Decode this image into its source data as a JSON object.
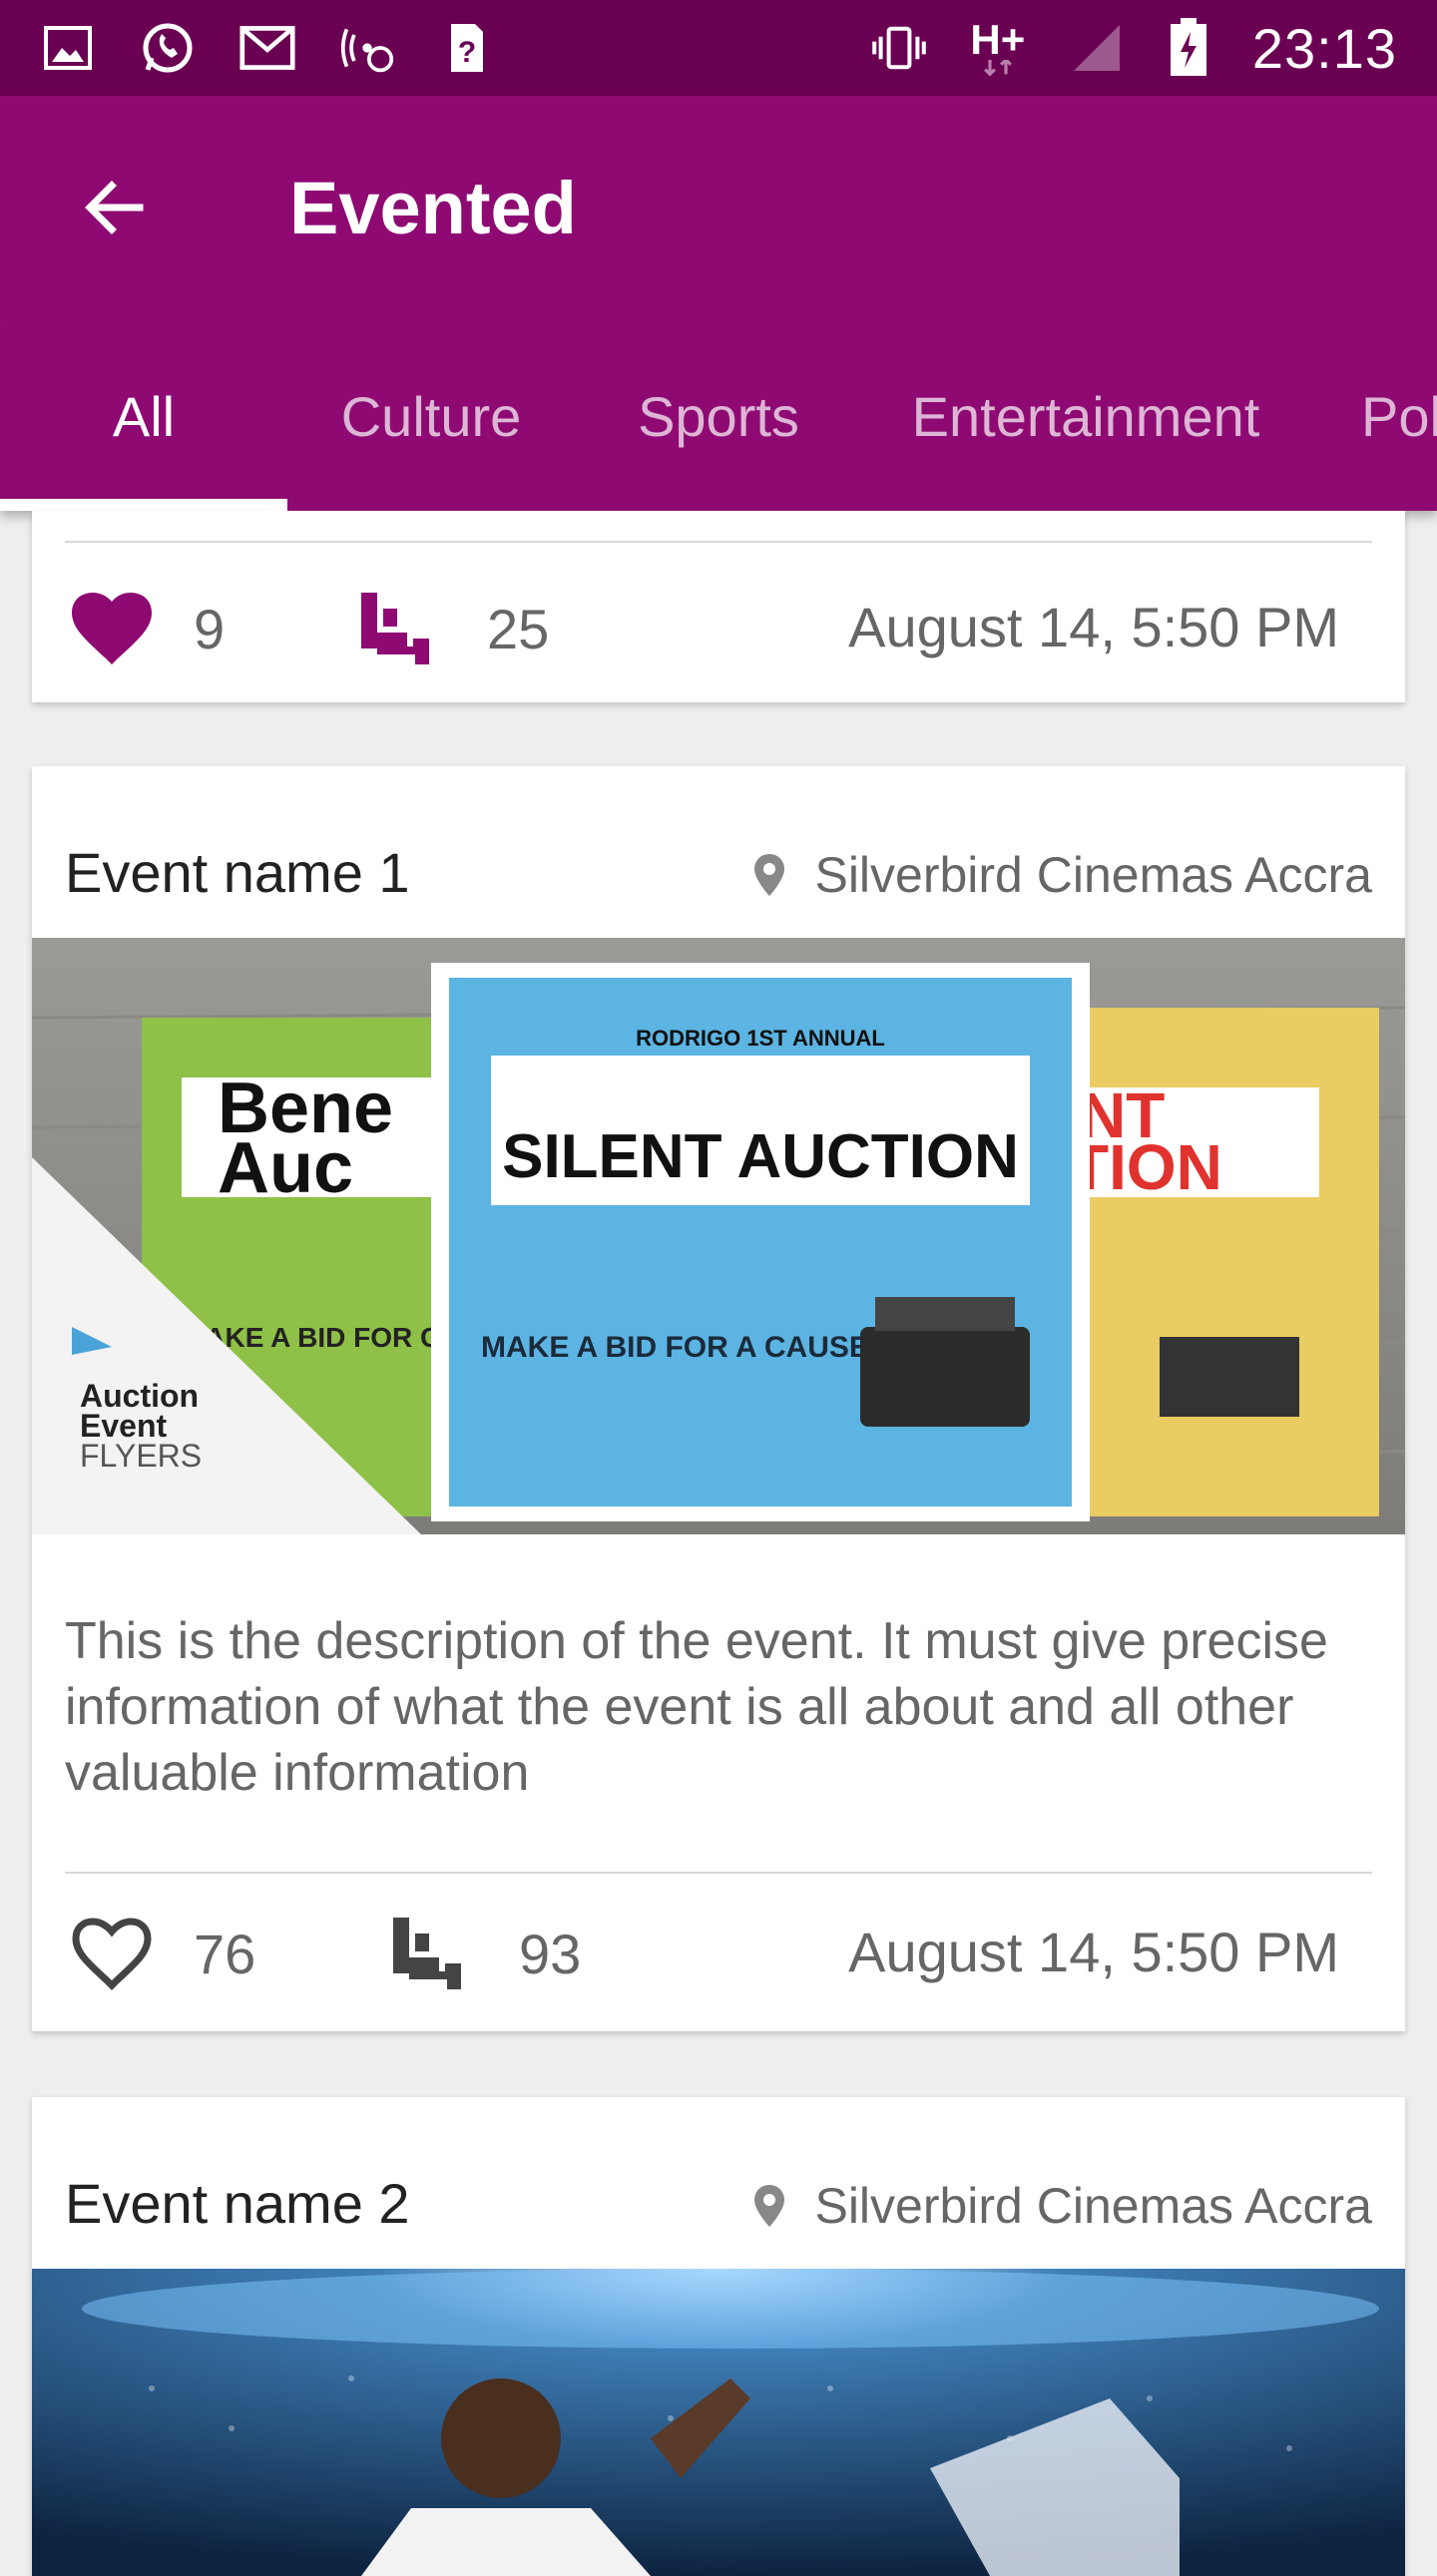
{
  "status_bar": {
    "time": "23:13",
    "network": "H+",
    "icons": [
      "gallery-icon",
      "whatsapp-icon",
      "gmail-icon",
      "wifi-calling-icon",
      "sim-unknown-icon",
      "vibrate-icon",
      "signal-icon",
      "battery-charging-icon"
    ]
  },
  "app_bar": {
    "title": "Evented"
  },
  "tabs": [
    {
      "label": "All",
      "active": true
    },
    {
      "label": "Culture"
    },
    {
      "label": "Sports"
    },
    {
      "label": "Entertainment"
    },
    {
      "label": "Pol"
    }
  ],
  "colors": {
    "primary": "#8e0a72",
    "primary_dark": "#6a0052",
    "text_secondary": "#666666"
  },
  "cards": [
    {
      "likes": "9",
      "liked": true,
      "seats": "25",
      "date": "August 14, 5:50 PM"
    },
    {
      "name": "Event name 1",
      "venue": "Silverbird Cinemas Accra",
      "image_texts": {
        "poster_center_top": "RODRIGO 1ST ANNUAL",
        "poster_center_title": "SILENT AUCTION",
        "poster_center_cta": "MAKE A BID FOR A CAUSE!",
        "poster_left_title1": "Bene",
        "poster_left_title2": "Auc",
        "poster_left_cta": "MAKE A BID FOR CAUSE!",
        "poster_right_title1": "NT",
        "poster_right_title2": "TION",
        "brand_line1": "Auction",
        "brand_line2": "Event",
        "brand_line3": "FLYERS"
      },
      "description": "This is the description of the event. It must give precise information of what the event is all about and all other valuable information",
      "likes": "76",
      "liked": false,
      "seats": "93",
      "date": "August 14, 5:50 PM"
    },
    {
      "name": "Event name 2",
      "venue": "Silverbird Cinemas Accra"
    }
  ]
}
